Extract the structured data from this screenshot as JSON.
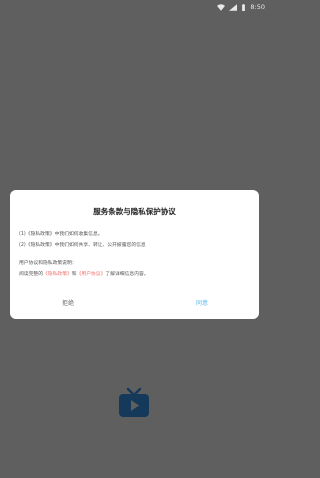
{
  "statusbar": {
    "time": "8:50",
    "icons": [
      "wifi-icon",
      "signal-icon",
      "battery-icon"
    ]
  },
  "dialog": {
    "title": "服务条款与隐私保护协议",
    "line1": "(1)《隐私政策》中我们如何收集信息。",
    "line2": "(2)《隐私政策》中我们如何共享、转让、公开披露您的信息",
    "line3": "用户协议和隐私政策说明：",
    "line4_prefix": "阅读完整的",
    "line4_link1": "《隐私政策》",
    "line4_mid": "和",
    "line4_link2": "《用户协议》",
    "line4_suffix": "了解详细信息内容。",
    "refuse_label": "拒绝",
    "agree_label": "同意"
  },
  "colors": {
    "background": "#5f5f5f",
    "link": "#f2706d",
    "agree": "#5db8ec",
    "tv_icon": "#15395a"
  },
  "app_icon": "tv-icon"
}
